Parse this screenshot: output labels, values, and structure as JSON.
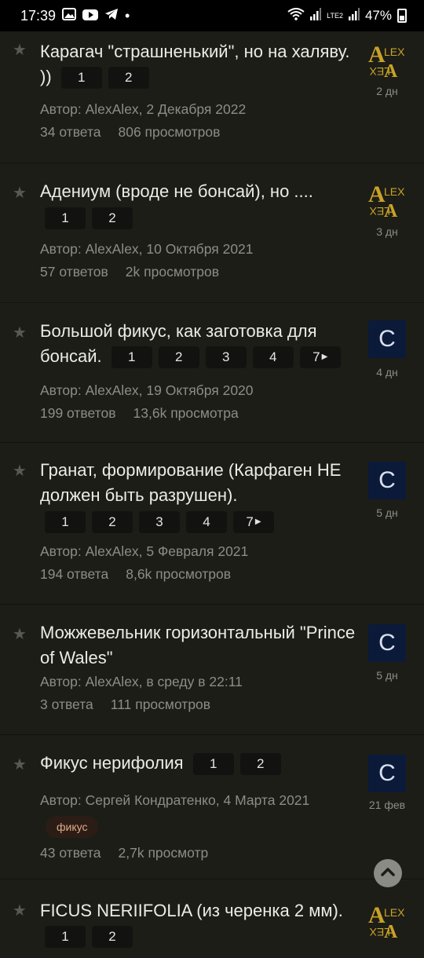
{
  "status_bar": {
    "time": "17:39",
    "dot": "•",
    "network": "LTE2",
    "battery": "47%"
  },
  "topics": [
    {
      "title": "Карагач \"страшненький\", но на халяву. ))",
      "pages": [
        "1",
        "2"
      ],
      "author": "Автор: AlexAlex, 2 Декабря 2022",
      "replies": "34 ответа",
      "views": "806 просмотров",
      "avatar_letter": "",
      "avatar_type": "alex-logo",
      "ago": "2 дн"
    },
    {
      "title": "Адениум (вроде не бонсай), но ....",
      "pages": [
        "1",
        "2"
      ],
      "author": "Автор: AlexAlex, 10 Октября 2021",
      "replies": "57 ответов",
      "views": "2k просмотров",
      "avatar_letter": "",
      "avatar_type": "alex-logo",
      "ago": "3 дн"
    },
    {
      "title": "Большой фикус, как заготовка для бонсай.",
      "pages": [
        "1",
        "2",
        "3",
        "4",
        "7"
      ],
      "author": "Автор: AlexAlex, 19 Октября 2020",
      "replies": "199 ответов",
      "views": "13,6k просмотра",
      "avatar_letter": "C",
      "avatar_type": "letter",
      "ago": "4 дн"
    },
    {
      "title": "Гранат, формирование (Карфаген НЕ должен быть разрушен).",
      "pages": [
        "1",
        "2",
        "3",
        "4",
        "7"
      ],
      "author": "Автор: AlexAlex, 5 Февраля 2021",
      "replies": "194 ответа",
      "views": "8,6k просмотров",
      "avatar_letter": "C",
      "avatar_type": "letter",
      "ago": "5 дн"
    },
    {
      "title": "Можжевельник горизонтальный \"Prince of Wales\"",
      "pages": [],
      "author": "Автор: AlexAlex, в среду в 22:11",
      "replies": "3 ответа",
      "views": "111 просмотров",
      "avatar_letter": "C",
      "avatar_type": "letter",
      "ago": "5 дн"
    },
    {
      "title": "Фикус нерифолия",
      "pages": [
        "1",
        "2"
      ],
      "author": "Автор: Сергей Кондратенко, 4 Марта 2021",
      "tag": "фикус",
      "replies": "43 ответа",
      "views": "2,7k просмотр",
      "avatar_letter": "C",
      "avatar_type": "letter",
      "ago": "21 фев"
    },
    {
      "title": "FICUS NERIIFOLIA (из черенка 2 мм).",
      "pages": [
        "1",
        "2"
      ],
      "avatar_letter": "",
      "avatar_type": "alex-logo"
    }
  ],
  "colors": {
    "background": "#1c1d17",
    "avatar_blue": "#0c1a3a",
    "logo_gold": "#c9a227",
    "tag_bg": "#2b1d15",
    "tag_text": "#e2a88a"
  }
}
